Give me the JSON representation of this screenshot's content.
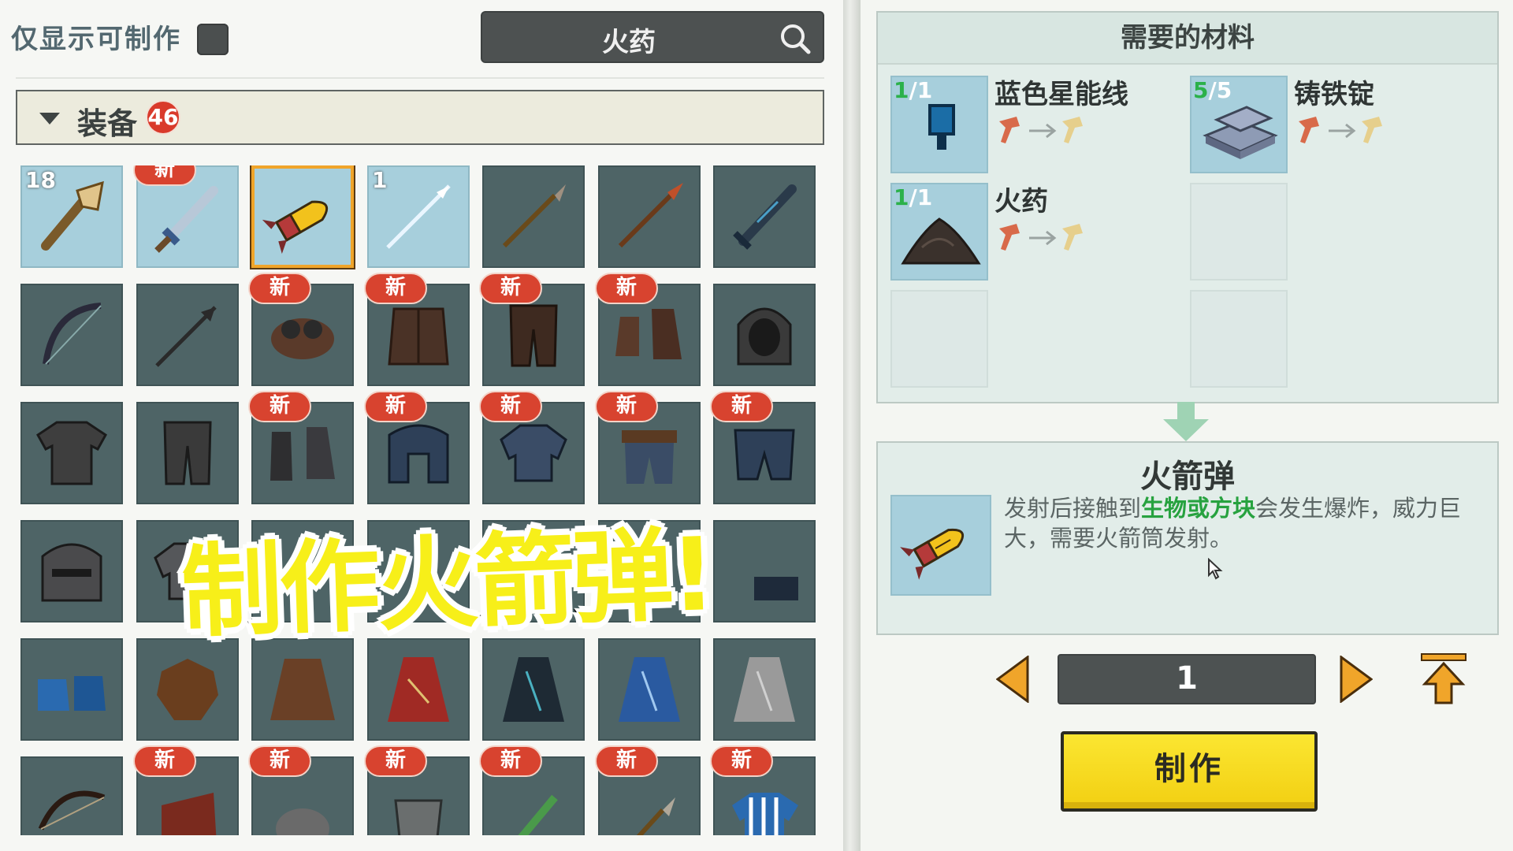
{
  "filter": {
    "label": "仅显示可制作",
    "checked": false
  },
  "search": {
    "value": "火药"
  },
  "category": {
    "label": "装备",
    "count": "46"
  },
  "grid": {
    "new_badge": "新",
    "items": [
      {
        "count": "18",
        "new": false,
        "icon": "torch-club",
        "light": true
      },
      {
        "count": "",
        "new": true,
        "icon": "blue-sword",
        "light": true
      },
      {
        "count": "",
        "new": false,
        "icon": "rocket-shell",
        "light": true,
        "selected": true
      },
      {
        "count": "1",
        "new": false,
        "icon": "ice-spear",
        "light": true
      },
      {
        "count": "",
        "new": false,
        "icon": "stone-spear"
      },
      {
        "count": "",
        "new": false,
        "icon": "fire-spear"
      },
      {
        "count": "",
        "new": false,
        "icon": "dark-sword"
      },
      {
        "count": "",
        "new": false,
        "icon": "bow"
      },
      {
        "count": "",
        "new": false,
        "icon": "arrow"
      },
      {
        "count": "",
        "new": true,
        "icon": "goggles-cap"
      },
      {
        "count": "",
        "new": true,
        "icon": "leather-vest"
      },
      {
        "count": "",
        "new": true,
        "icon": "leather-pants"
      },
      {
        "count": "",
        "new": true,
        "icon": "leather-boots"
      },
      {
        "count": "",
        "new": false,
        "icon": "chain-hood"
      },
      {
        "count": "",
        "new": false,
        "icon": "chain-shirt"
      },
      {
        "count": "",
        "new": false,
        "icon": "chain-pants"
      },
      {
        "count": "",
        "new": true,
        "icon": "iron-boots"
      },
      {
        "count": "",
        "new": true,
        "icon": "iron-helmet"
      },
      {
        "count": "",
        "new": true,
        "icon": "iron-chestplate"
      },
      {
        "count": "",
        "new": true,
        "icon": "belt-pants"
      },
      {
        "count": "",
        "new": true,
        "icon": "iron-greaves"
      },
      {
        "count": "",
        "new": false,
        "icon": "knight-helmet"
      },
      {
        "count": "",
        "new": false,
        "icon": "plate-armor"
      },
      {
        "count": "",
        "new": false,
        "icon": "hidden"
      },
      {
        "count": "",
        "new": false,
        "icon": "hidden"
      },
      {
        "count": "",
        "new": false,
        "icon": "hidden"
      },
      {
        "count": "",
        "new": false,
        "icon": "hidden"
      },
      {
        "count": "",
        "new": false,
        "icon": "dark-boots"
      },
      {
        "count": "",
        "new": false,
        "icon": "blue-boots"
      },
      {
        "count": "",
        "new": false,
        "icon": "leather-scrap"
      },
      {
        "count": "",
        "new": false,
        "icon": "brown-cloak"
      },
      {
        "count": "",
        "new": false,
        "icon": "red-cape"
      },
      {
        "count": "",
        "new": false,
        "icon": "dark-cape"
      },
      {
        "count": "",
        "new": false,
        "icon": "blue-cape"
      },
      {
        "count": "",
        "new": false,
        "icon": "grey-cape"
      },
      {
        "count": "",
        "new": false,
        "icon": "recurve-bow"
      },
      {
        "count": "",
        "new": true,
        "icon": "red-cloth"
      },
      {
        "count": "",
        "new": true,
        "icon": "stone"
      },
      {
        "count": "",
        "new": true,
        "icon": "bucket"
      },
      {
        "count": "",
        "new": true,
        "icon": "bamboo"
      },
      {
        "count": "",
        "new": true,
        "icon": "spear-tip"
      },
      {
        "count": "",
        "new": true,
        "icon": "striped-shirt"
      }
    ]
  },
  "overlay_caption": "制作火箭弹!",
  "materials": {
    "title": "需要的材料",
    "items": [
      {
        "have": "1",
        "need": "1",
        "name": "蓝色星能线",
        "icon": "blue-star-wire"
      },
      {
        "have": "5",
        "need": "5",
        "name": "铸铁锭",
        "icon": "cast-iron-ingot"
      },
      {
        "have": "1",
        "need": "1",
        "name": "火药",
        "icon": "gunpowder"
      }
    ]
  },
  "product": {
    "title": "火箭弹",
    "desc_pre": "发射后接触到",
    "desc_hl": "生物或方块",
    "desc_post": "会发生爆炸，威力巨大，需要火箭筒发射。",
    "icon": "rocket-shell"
  },
  "quantity": {
    "value": "1"
  },
  "craft_button": "制作",
  "colors": {
    "accent_orange": "#f0a52a",
    "button_yellow": "#f2d91a",
    "highlight_green": "#27a23f",
    "badge_red": "#d8432f"
  }
}
